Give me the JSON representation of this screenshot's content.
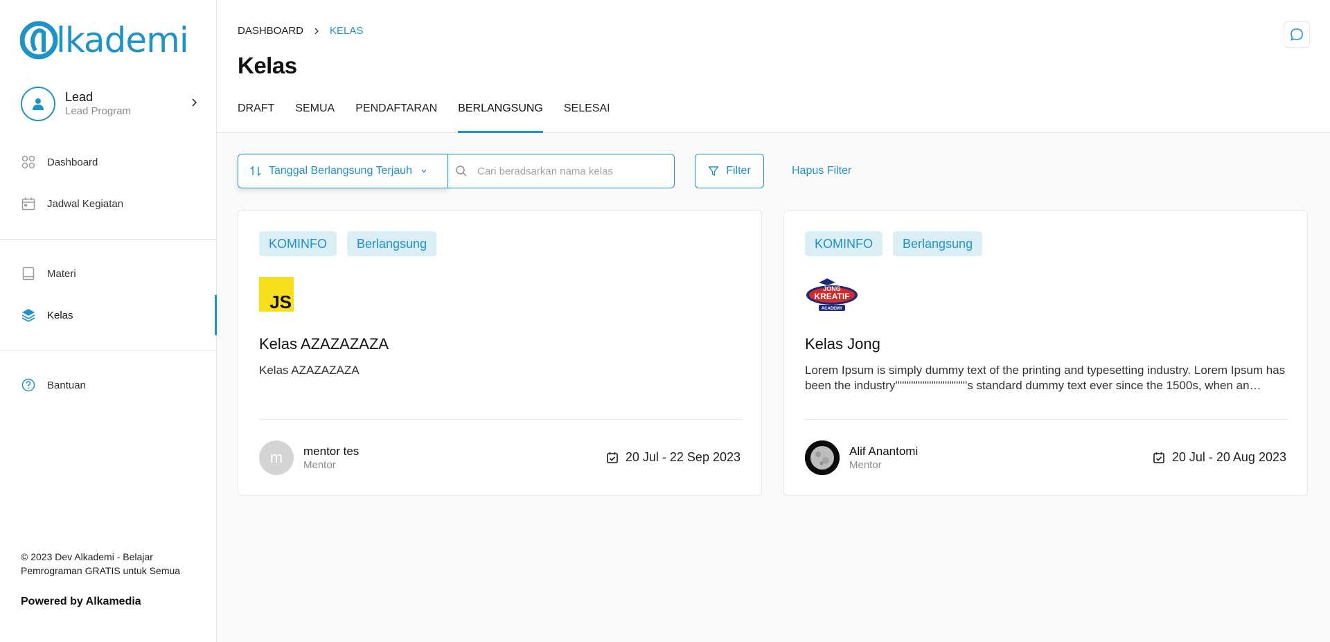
{
  "brand": {
    "logo_text": "lkademi",
    "accent": "#1e93c7"
  },
  "profile": {
    "name": "Lead",
    "role": "Lead Program"
  },
  "sidebar": {
    "items": [
      {
        "label": "Dashboard",
        "icon": "grid-icon"
      },
      {
        "label": "Jadwal Kegiatan",
        "icon": "calendar-icon"
      },
      {
        "label": "Materi",
        "icon": "book-icon"
      },
      {
        "label": "Kelas",
        "icon": "layers-icon",
        "active": true
      },
      {
        "label": "Bantuan",
        "icon": "help-icon"
      }
    ],
    "footer_copyright": "© 2023 Dev Alkademi - Belajar Pemrograman GRATIS untuk Semua",
    "footer_powered": "Powered by Alkamedia"
  },
  "breadcrumb": {
    "root": "DASHBOARD",
    "current": "KELAS"
  },
  "page_title": "Kelas",
  "tabs": [
    {
      "label": "DRAFT"
    },
    {
      "label": "SEMUA"
    },
    {
      "label": "PENDAFTARAN"
    },
    {
      "label": "BERLANGSUNG",
      "active": true
    },
    {
      "label": "SELESAI"
    }
  ],
  "toolbar": {
    "sort_label": "Tanggal Berlangsung Terjauh",
    "search_placeholder": "Cari beradsarkan nama kelas",
    "search_value": "",
    "filter_label": "Filter",
    "clear_filter_label": "Hapus Filter"
  },
  "cards": [
    {
      "tags": [
        "KOMINFO",
        "Berlangsung"
      ],
      "thumb_text": "JS",
      "title": "Kelas AZAZAZAZA",
      "description": "Kelas AZAZAZAZA",
      "mentor_initial": "m",
      "mentor_name": "mentor tes",
      "mentor_role": "Mentor",
      "dates": "20 Jul - 22 Sep 2023"
    },
    {
      "tags": [
        "KOMINFO",
        "Berlangsung"
      ],
      "thumb_text": "JONG KREATIF ACADEMY",
      "title": "Kelas Jong",
      "description": "Lorem Ipsum is simply dummy text of the printing and typesetting industry. Lorem Ipsum has been the industry''''''''''''''''''''''''''''''''s standard dummy text ever since the 1500s, when an unknown printer took a galley of type and scrambled it to make a type specimen book.",
      "mentor_initial": "",
      "mentor_name": "Alif Anantomi",
      "mentor_role": "Mentor",
      "dates": "20 Jul - 20 Aug 2023"
    }
  ]
}
